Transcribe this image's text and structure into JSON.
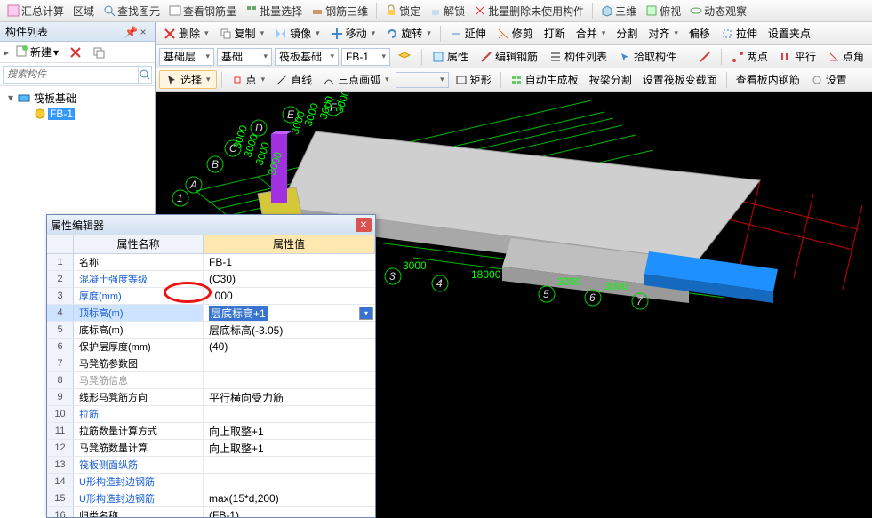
{
  "top_toolbar": {
    "items": [
      "汇总计算",
      "区域",
      "查找图元",
      "查看钢筋量",
      "批量选择",
      "钢筋三维",
      "锁定",
      "解锁",
      "批量删除未使用构件",
      "三维",
      "俯视",
      "动态观察"
    ]
  },
  "left_panel": {
    "title": "构件列表",
    "new_btn": "新建",
    "search_placeholder": "搜索构件",
    "tree": {
      "root": "筏板基础",
      "child": "FB-1"
    }
  },
  "cmd_bar": {
    "items": [
      "删除",
      "复制",
      "镜像",
      "移动",
      "旋转",
      "延伸",
      "修剪",
      "打断",
      "合并",
      "分割",
      "对齐",
      "偏移",
      "拉伸",
      "设置夹点"
    ]
  },
  "layer_bar": {
    "floor": "基础层",
    "category": "基础",
    "subcat": "筏板基础",
    "member": "FB-1",
    "props_btn": "属性",
    "edit_rebar": "编辑钢筋",
    "member_list": "构件列表",
    "pick_member": "拾取构件",
    "two_point": "两点",
    "parallel": "平行",
    "point_angle": "点角"
  },
  "draw_bar": {
    "select": "选择",
    "point": "点",
    "line": "直线",
    "arc3": "三点画弧",
    "rect": "矩形",
    "auto_slab": "自动生成板",
    "split_by_beam": "按梁分割",
    "set_raft_section": "设置筏板变截面",
    "view_slab_rebar": "查看板内钢筋",
    "set": "设置"
  },
  "viewport": {
    "axis_letters": [
      "A",
      "B",
      "C",
      "D",
      "E",
      "F"
    ],
    "axis_numbers": [
      "3",
      "4",
      "5",
      "6",
      "7"
    ],
    "dim_v": "3000",
    "dims_h": [
      "3000",
      "18000",
      "3000",
      "3000"
    ]
  },
  "prop_dlg": {
    "title": "属性编辑器",
    "col_name": "属性名称",
    "col_value": "属性值",
    "rows": [
      {
        "n": "1",
        "a": "名称",
        "b": "FB-1"
      },
      {
        "n": "2",
        "a": "混凝土强度等级",
        "b": "(C30)",
        "alink": true
      },
      {
        "n": "3",
        "a": "厚度(mm)",
        "b": "1000",
        "alink": true
      },
      {
        "n": "4",
        "a": "顶标高(m)",
        "b": "层底标高+1",
        "alink": true,
        "hl": true,
        "selval": true,
        "dd": true
      },
      {
        "n": "5",
        "a": "底标高(m)",
        "b": "层底标高(-3.05)"
      },
      {
        "n": "6",
        "a": "保护层厚度(mm)",
        "b": "(40)"
      },
      {
        "n": "7",
        "a": "马凳筋参数图"
      },
      {
        "n": "8",
        "a": "马凳筋信息",
        "gray": true
      },
      {
        "n": "9",
        "a": "线形马凳筋方向",
        "b": "平行横向受力筋"
      },
      {
        "n": "10",
        "a": "拉筋",
        "alink": true
      },
      {
        "n": "11",
        "a": "拉筋数量计算方式",
        "b": "向上取整+1"
      },
      {
        "n": "12",
        "a": "马凳筋数量计算",
        "b": "向上取整+1"
      },
      {
        "n": "13",
        "a": "筏板侧面纵筋",
        "alink": true
      },
      {
        "n": "14",
        "a": "U形构造封边钢筋",
        "alink": true
      },
      {
        "n": "15",
        "a": "U形构造封边钢筋",
        "b": "max(15*d,200)",
        "alink": true
      },
      {
        "n": "16",
        "a": "归类名称",
        "b": "(FB-1)"
      }
    ]
  }
}
